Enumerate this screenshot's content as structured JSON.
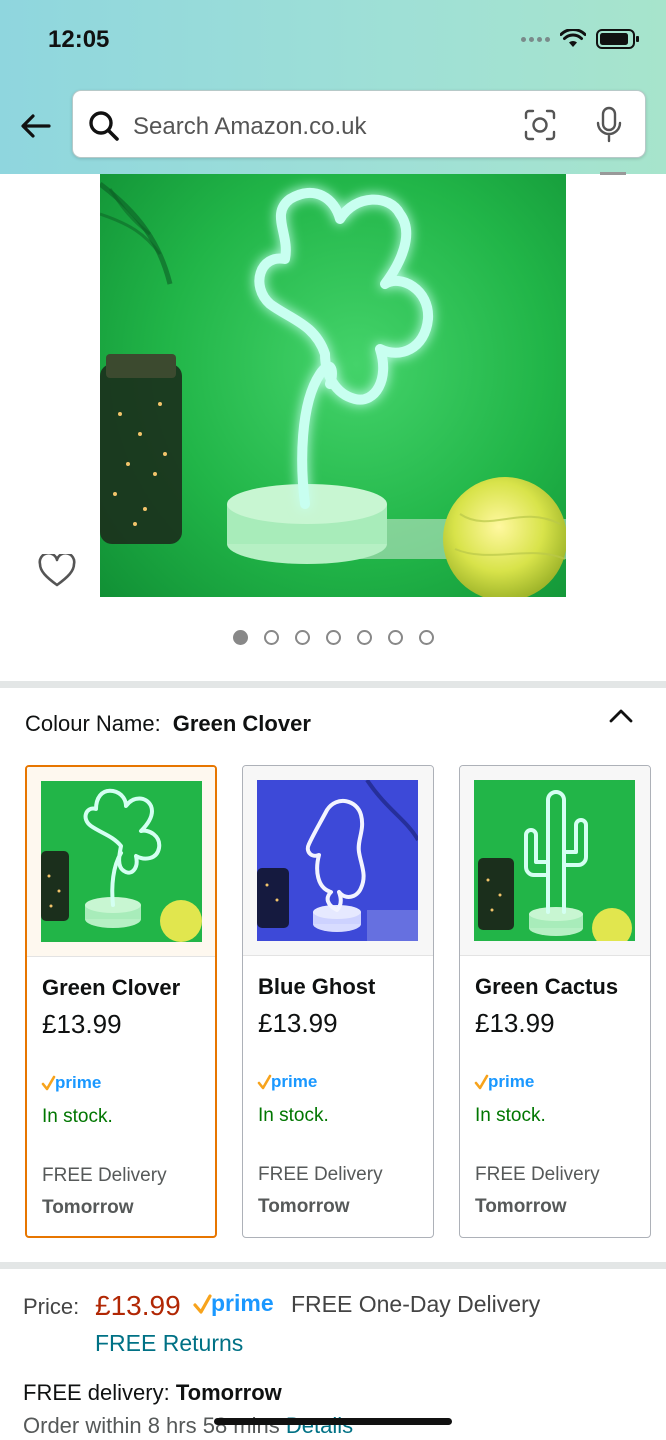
{
  "status_bar": {
    "time": "12:05"
  },
  "search": {
    "placeholder": "Search Amazon.co.uk"
  },
  "gallery": {
    "dots_total": 7,
    "active_dot": 1
  },
  "colour": {
    "label": "Colour Name:",
    "selected": "Green Clover"
  },
  "variants": [
    {
      "name": "Green Clover",
      "price": "£13.99",
      "stock": "In stock.",
      "delivery": "FREE Delivery",
      "when": "Tomorrow",
      "selected": true
    },
    {
      "name": "Blue Ghost",
      "price": "£13.99",
      "stock": "In stock.",
      "delivery": "FREE Delivery",
      "when": "Tomorrow",
      "selected": false
    },
    {
      "name": "Green Cactus",
      "price": "£13.99",
      "stock": "In stock.",
      "delivery": "FREE Delivery",
      "when": "Tomorrow",
      "selected": false
    }
  ],
  "prime_label": "prime",
  "price_block": {
    "label": "Price:",
    "value": "£13.99",
    "one_day": "FREE One-Day Delivery",
    "returns": "FREE Returns",
    "free_delivery_label": "FREE delivery:",
    "free_delivery_when": "Tomorrow",
    "order_within": "Order within 8 hrs 58 mins",
    "details_link": "Details"
  },
  "colors": {
    "accent_orange": "#e77600",
    "price_red": "#b12704",
    "stock_green": "#007600",
    "link_teal": "#007185",
    "prime_blue": "#1a98ff"
  }
}
